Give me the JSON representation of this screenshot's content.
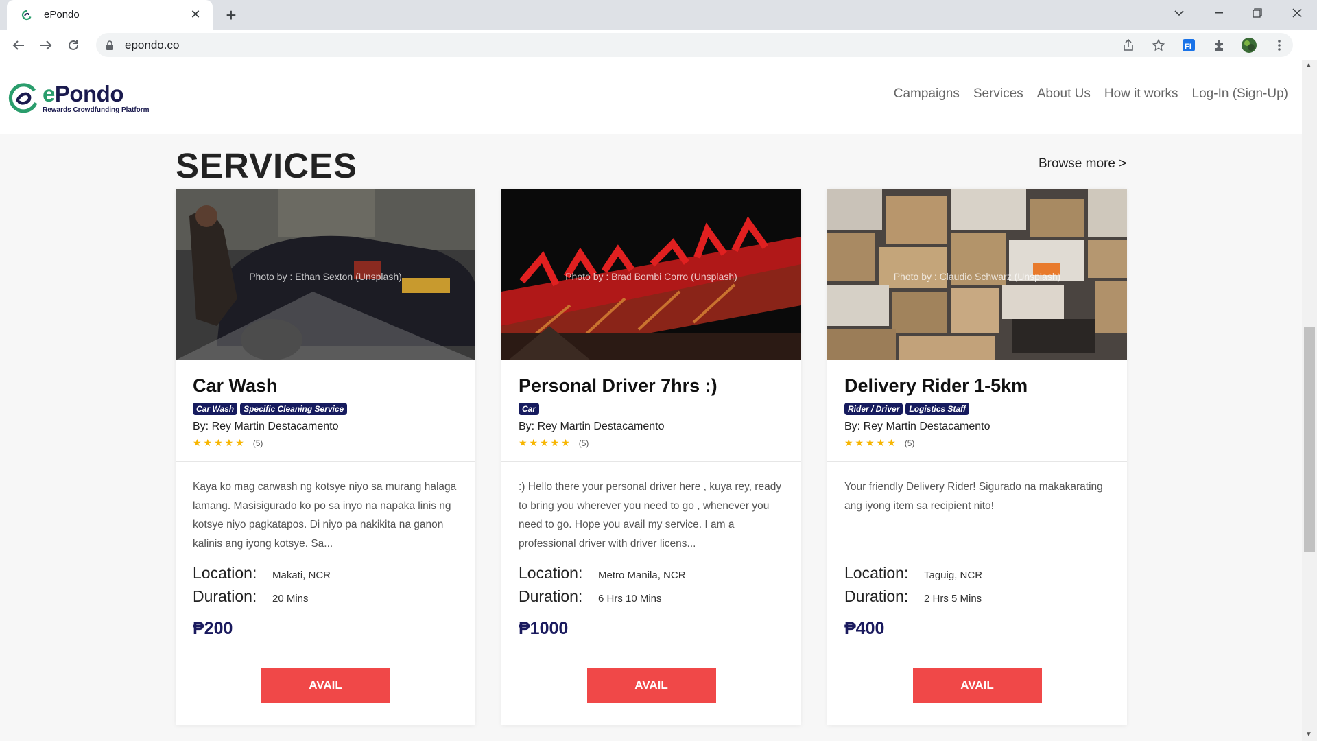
{
  "browser": {
    "tab_title": "ePondo",
    "url": "epondo.co"
  },
  "site": {
    "logo_name": "Pondo",
    "logo_e": "e",
    "logo_tagline": "Rewards Crowdfunding Platform",
    "nav": [
      "Campaigns",
      "Services",
      "About Us",
      "How it works",
      "Log-In (Sign-Up)"
    ]
  },
  "section": {
    "title": "SERVICES",
    "browse_more": "Browse more >"
  },
  "labels": {
    "location": "Location:",
    "duration": "Duration:",
    "avail": "AVAIL",
    "stars": "★★★★★"
  },
  "cards": [
    {
      "title": "Car Wash",
      "tags": [
        "Car Wash",
        "Specific Cleaning Service"
      ],
      "author": "By: Rey Martin Destacamento",
      "rating_count": "(5)",
      "image_credit": "Photo by : Ethan Sexton (Unsplash)",
      "description": "Kaya ko mag carwash ng kotsye niyo sa murang halaga lamang. Masisigurado ko po sa inyo na napaka linis ng kotsye niyo pagkatapos. Di niyo pa nakikita na ganon kalinis ang iyong kotsye. Sa...",
      "location": "Makati, NCR",
      "duration": "20 Mins",
      "price": "₱200"
    },
    {
      "title": "Personal Driver 7hrs :)",
      "tags": [
        "Car"
      ],
      "author": "By: Rey Martin Destacamento",
      "rating_count": "(5)",
      "image_credit": "Photo by : Brad Bombi Corro (Unsplash)",
      "description": ":) Hello there your personal driver here , kuya rey, ready to bring you wherever you need to go , whenever you need to go. Hope you avail my service. I am a professional driver with driver licens...",
      "location": "Metro Manila, NCR",
      "duration": "6 Hrs 10 Mins",
      "price": "₱1000"
    },
    {
      "title": "Delivery Rider 1-5km",
      "tags": [
        "Rider / Driver",
        "Logistics Staff"
      ],
      "author": "By: Rey Martin Destacamento",
      "rating_count": "(5)",
      "image_credit": "Photo by : Claudio Schwarz (Unsplash)",
      "description": "Your friendly Delivery Rider! Sigurado na makakarating ang iyong item sa recipient nito!",
      "location": "Taguig, NCR",
      "duration": "2 Hrs 5 Mins",
      "price": "₱400"
    }
  ],
  "colors": {
    "brand_navy": "#1a1a4e",
    "brand_green": "#2a9d6c",
    "tag_bg": "#161b5e",
    "avail_red": "#f04848",
    "star": "#f7b500"
  }
}
